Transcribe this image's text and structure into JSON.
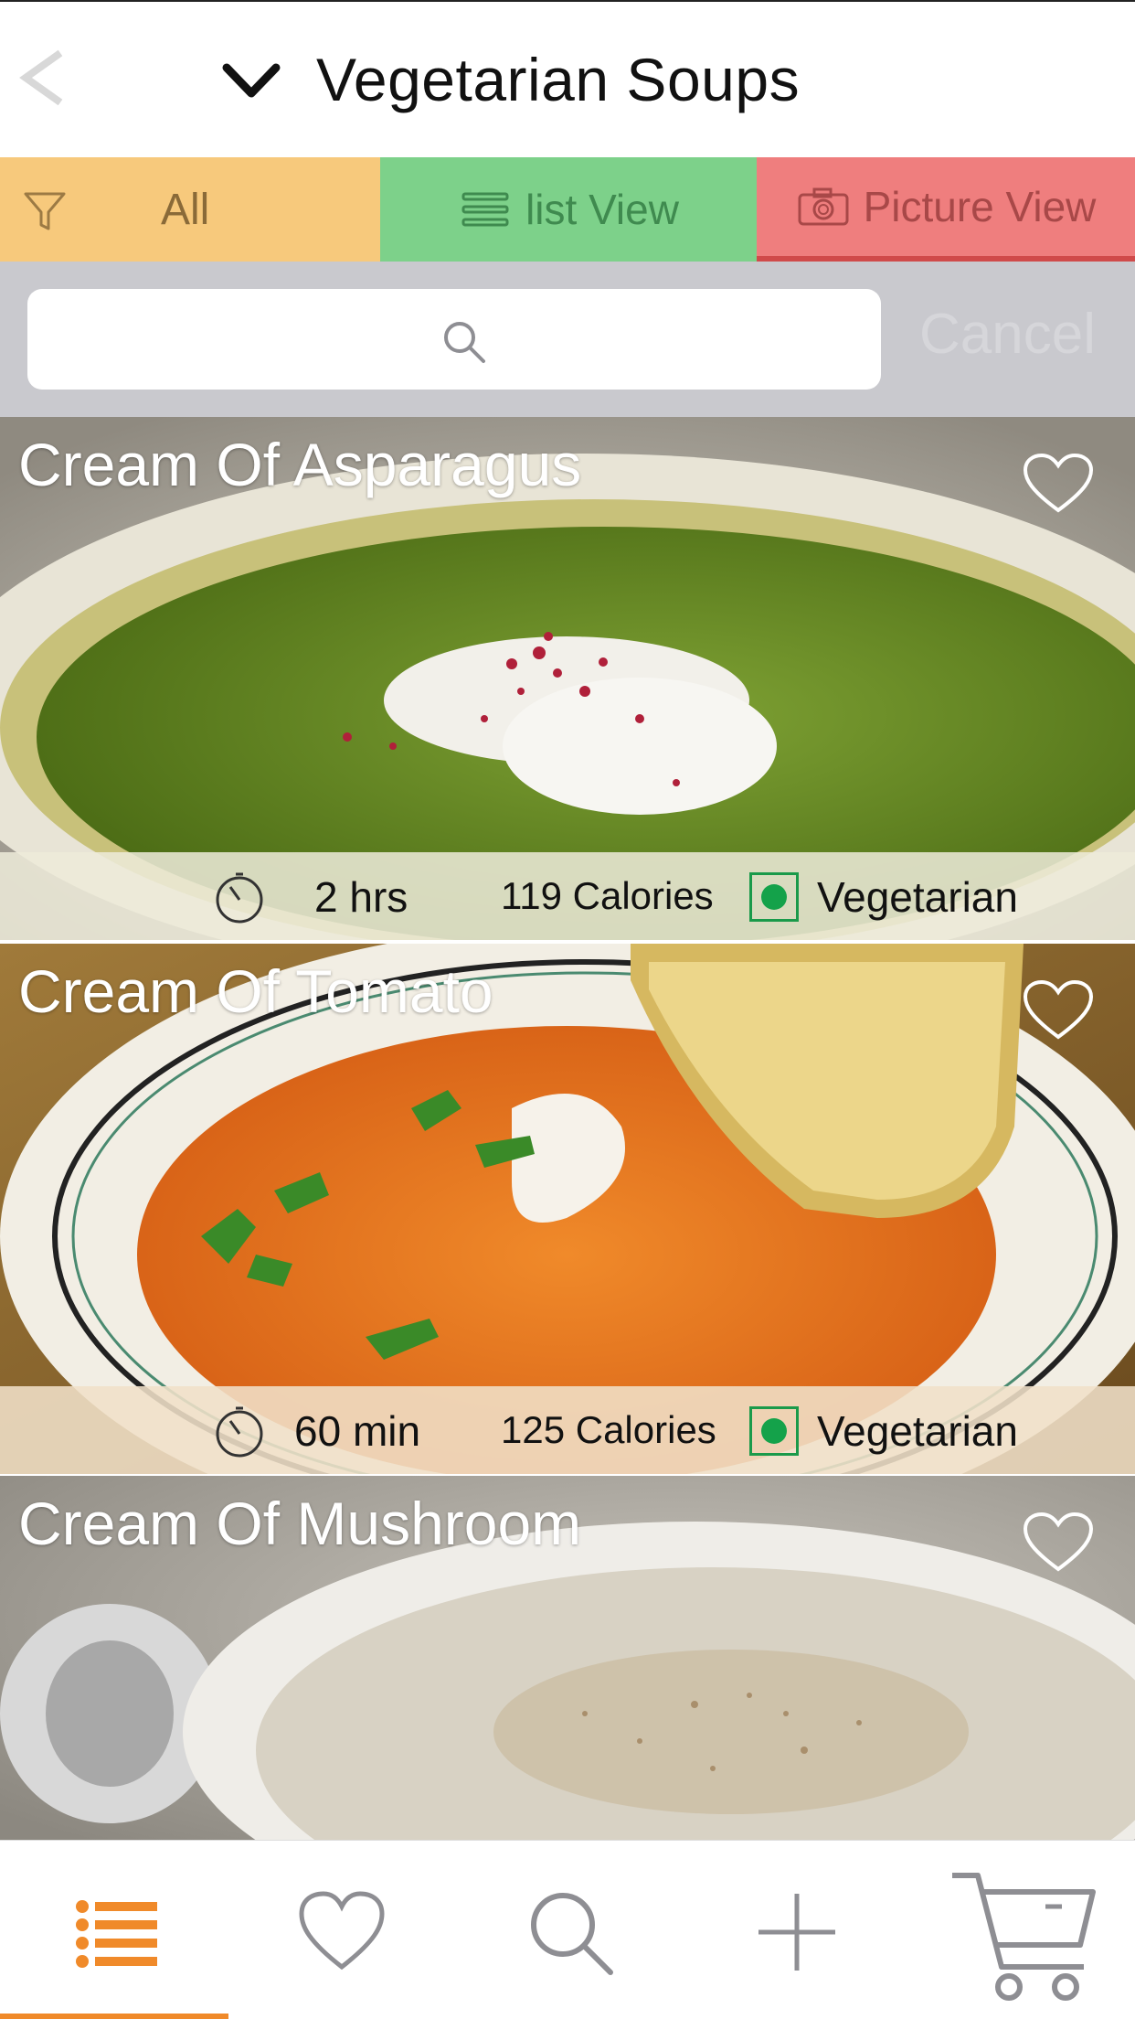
{
  "header": {
    "back_label": "<",
    "title": "Vegetarian Soups"
  },
  "segments": {
    "all_label": "All",
    "list_label": "list View",
    "picture_label": "Picture View"
  },
  "search": {
    "placeholder": "",
    "cancel_label": "Cancel"
  },
  "recipes": [
    {
      "title": "Cream Of Asparagus",
      "time": "2 hrs",
      "calories": "119 Calories",
      "diet": "Vegetarian",
      "favorited": false
    },
    {
      "title": "Cream Of Tomato",
      "time": "60 min",
      "calories": "125 Calories",
      "diet": "Vegetarian",
      "favorited": false
    },
    {
      "title": "Cream Of Mushroom",
      "favorited": false
    }
  ],
  "tabbar": {
    "items": [
      "list-icon",
      "heart-icon",
      "search-icon",
      "plus-icon",
      "cart-icon"
    ],
    "active": "list-icon",
    "accent": "#f08a2a"
  },
  "colors": {
    "all_segment": "#f7c97c",
    "list_segment": "#7dd18a",
    "picture_segment": "#ef7e7e",
    "veg_indicator": "#14a24a"
  }
}
